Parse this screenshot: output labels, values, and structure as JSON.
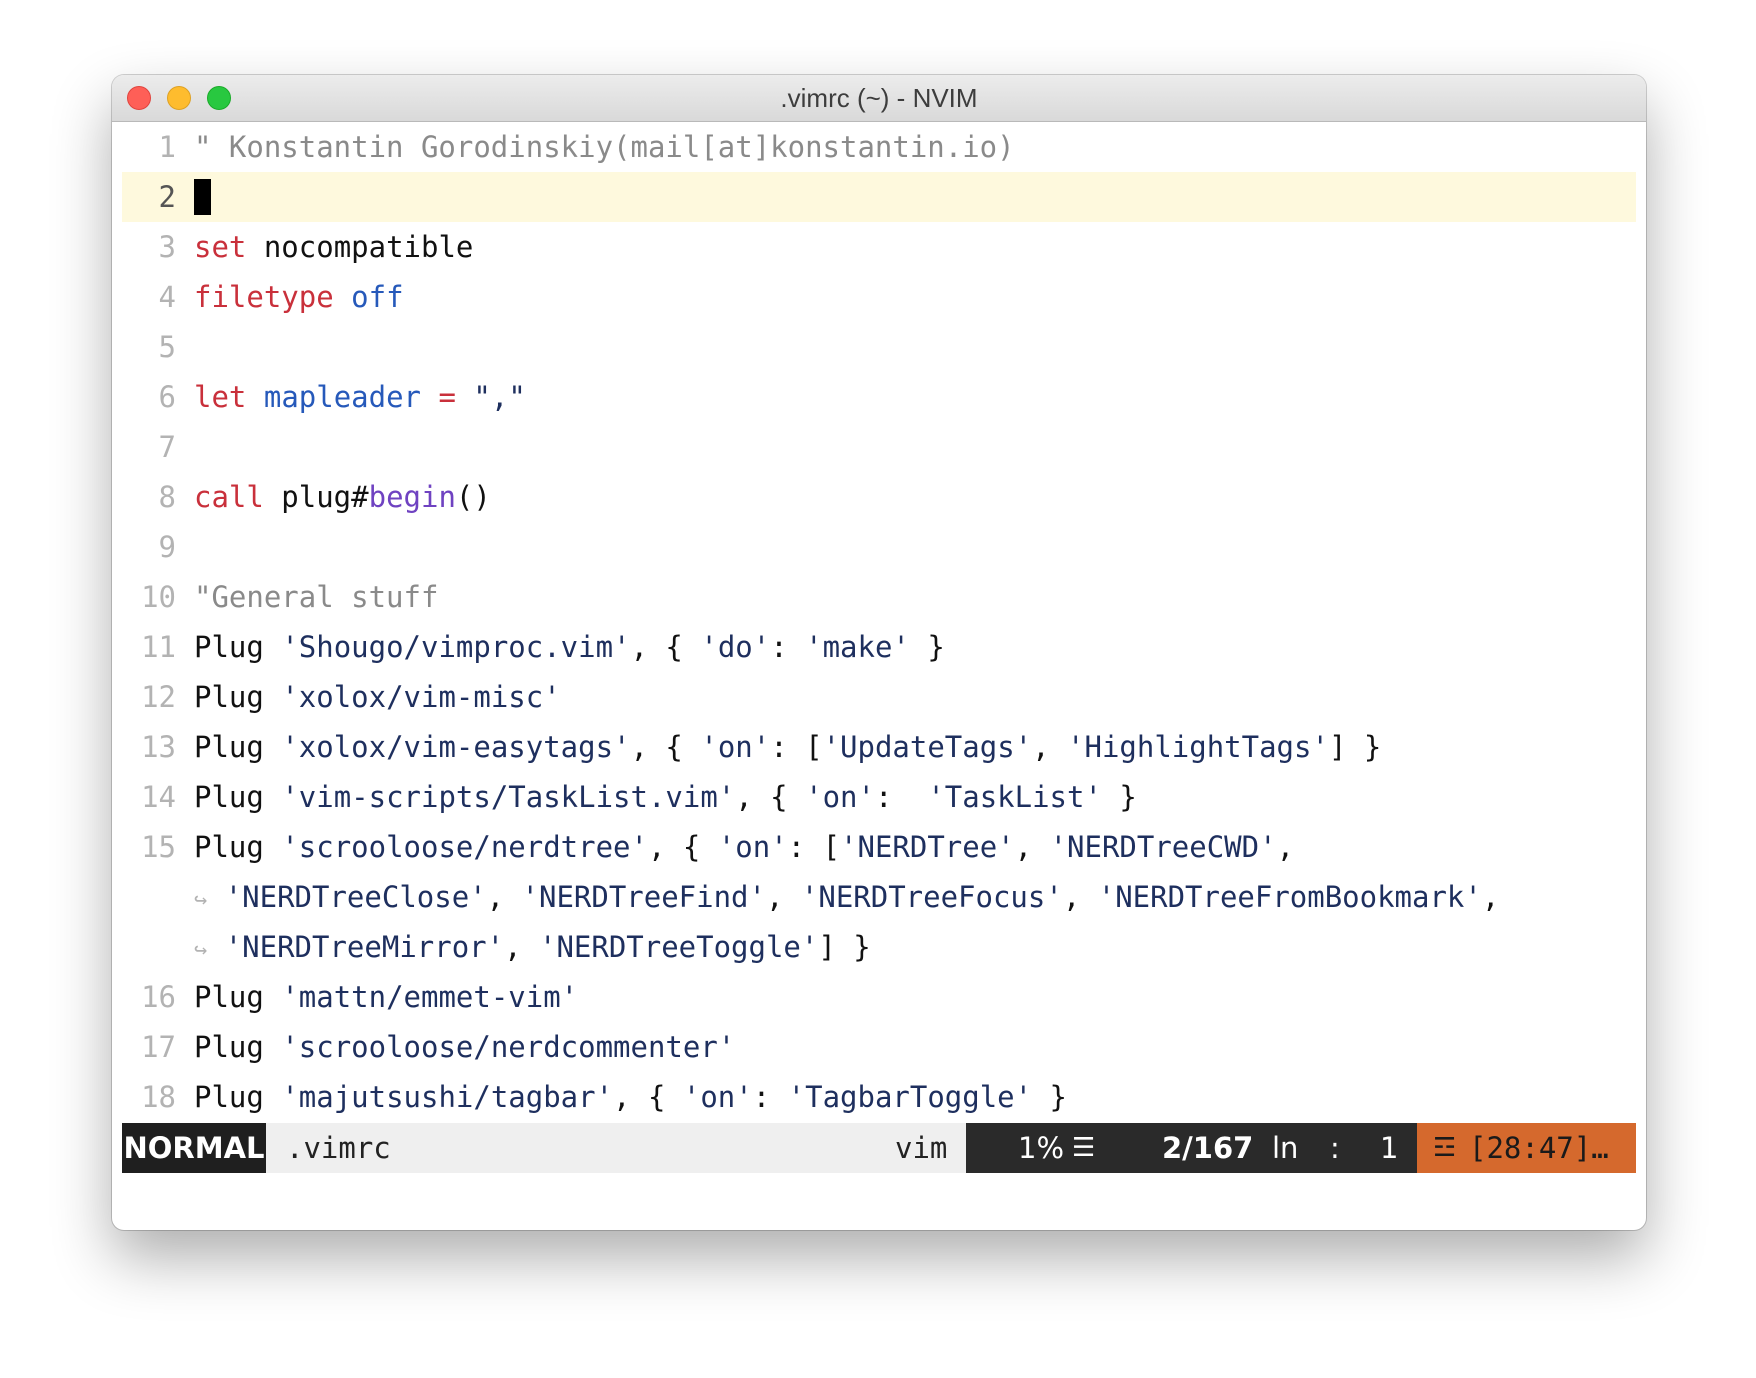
{
  "window": {
    "title": ".vimrc (~) - NVIM"
  },
  "editor": {
    "current_line": 2,
    "lines": [
      {
        "num": "1",
        "segments": [
          {
            "t": "\" Konstantin Gorodinskiy(mail[at]konstantin.io)",
            "c": "comment"
          }
        ]
      },
      {
        "num": "2",
        "cursor": true,
        "segments": []
      },
      {
        "num": "3",
        "segments": [
          {
            "t": "set",
            "c": "kw"
          },
          {
            "t": " nocompatible",
            "c": ""
          }
        ]
      },
      {
        "num": "4",
        "segments": [
          {
            "t": "filetype",
            "c": "kw"
          },
          {
            "t": " ",
            "c": ""
          },
          {
            "t": "off",
            "c": "blue"
          }
        ]
      },
      {
        "num": "5",
        "segments": []
      },
      {
        "num": "6",
        "segments": [
          {
            "t": "let",
            "c": "kw"
          },
          {
            "t": " ",
            "c": ""
          },
          {
            "t": "mapleader",
            "c": "blue"
          },
          {
            "t": " ",
            "c": ""
          },
          {
            "t": "=",
            "c": "kw"
          },
          {
            "t": " \",\"",
            "c": "str"
          }
        ]
      },
      {
        "num": "7",
        "segments": []
      },
      {
        "num": "8",
        "segments": [
          {
            "t": "call",
            "c": "kw"
          },
          {
            "t": " plug#",
            "c": ""
          },
          {
            "t": "begin",
            "c": "fn"
          },
          {
            "t": "()",
            "c": ""
          }
        ]
      },
      {
        "num": "9",
        "segments": []
      },
      {
        "num": "10",
        "segments": [
          {
            "t": "\"General stuff",
            "c": "comment"
          }
        ]
      },
      {
        "num": "11",
        "segments": [
          {
            "t": "Plug ",
            "c": ""
          },
          {
            "t": "'Shougo/vimproc.vim'",
            "c": "str"
          },
          {
            "t": ", { ",
            "c": ""
          },
          {
            "t": "'do'",
            "c": "str"
          },
          {
            "t": ": ",
            "c": ""
          },
          {
            "t": "'make'",
            "c": "str"
          },
          {
            "t": " }",
            "c": ""
          }
        ]
      },
      {
        "num": "12",
        "segments": [
          {
            "t": "Plug ",
            "c": ""
          },
          {
            "t": "'xolox/vim-misc'",
            "c": "str"
          }
        ]
      },
      {
        "num": "13",
        "segments": [
          {
            "t": "Plug ",
            "c": ""
          },
          {
            "t": "'xolox/vim-easytags'",
            "c": "str"
          },
          {
            "t": ", { ",
            "c": ""
          },
          {
            "t": "'on'",
            "c": "str"
          },
          {
            "t": ": [",
            "c": ""
          },
          {
            "t": "'UpdateTags'",
            "c": "str"
          },
          {
            "t": ", ",
            "c": ""
          },
          {
            "t": "'HighlightTags'",
            "c": "str"
          },
          {
            "t": "] }",
            "c": ""
          }
        ]
      },
      {
        "num": "14",
        "segments": [
          {
            "t": "Plug ",
            "c": ""
          },
          {
            "t": "'vim-scripts/TaskList.vim'",
            "c": "str"
          },
          {
            "t": ", { ",
            "c": ""
          },
          {
            "t": "'on'",
            "c": "str"
          },
          {
            "t": ":  ",
            "c": ""
          },
          {
            "t": "'TaskList'",
            "c": "str"
          },
          {
            "t": " }",
            "c": ""
          }
        ]
      },
      {
        "num": "15",
        "segments": [
          {
            "t": "Plug ",
            "c": ""
          },
          {
            "t": "'scrooloose/nerdtree'",
            "c": "str"
          },
          {
            "t": ", { ",
            "c": ""
          },
          {
            "t": "'on'",
            "c": "str"
          },
          {
            "t": ": [",
            "c": ""
          },
          {
            "t": "'NERDTree'",
            "c": "str"
          },
          {
            "t": ", ",
            "c": ""
          },
          {
            "t": "'NERDTreeCWD'",
            "c": "str"
          },
          {
            "t": ",",
            "c": ""
          }
        ]
      },
      {
        "num": "",
        "wrap": true,
        "segments": [
          {
            "t": "'NERDTreeClose'",
            "c": "str"
          },
          {
            "t": ", ",
            "c": ""
          },
          {
            "t": "'NERDTreeFind'",
            "c": "str"
          },
          {
            "t": ", ",
            "c": ""
          },
          {
            "t": "'NERDTreeFocus'",
            "c": "str"
          },
          {
            "t": ", ",
            "c": ""
          },
          {
            "t": "'NERDTreeFromBookmark'",
            "c": "str"
          },
          {
            "t": ",",
            "c": ""
          }
        ]
      },
      {
        "num": "",
        "wrap": true,
        "segments": [
          {
            "t": "'NERDTreeMirror'",
            "c": "str"
          },
          {
            "t": ", ",
            "c": ""
          },
          {
            "t": "'NERDTreeToggle'",
            "c": "str"
          },
          {
            "t": "] }",
            "c": ""
          }
        ]
      },
      {
        "num": "16",
        "segments": [
          {
            "t": "Plug ",
            "c": ""
          },
          {
            "t": "'mattn/emmet-vim'",
            "c": "str"
          }
        ]
      },
      {
        "num": "17",
        "segments": [
          {
            "t": "Plug ",
            "c": ""
          },
          {
            "t": "'scrooloose/nerdcommenter'",
            "c": "str"
          }
        ]
      },
      {
        "num": "18",
        "segments": [
          {
            "t": "Plug ",
            "c": ""
          },
          {
            "t": "'majutsushi/tagbar'",
            "c": "str"
          },
          {
            "t": ", { ",
            "c": ""
          },
          {
            "t": "'on'",
            "c": "str"
          },
          {
            "t": ": ",
            "c": ""
          },
          {
            "t": "'TagbarToggle'",
            "c": "str"
          },
          {
            "t": " }",
            "c": ""
          }
        ]
      }
    ]
  },
  "wrap_marker": "↪",
  "statusline": {
    "mode": "NORMAL",
    "filename": ".vimrc",
    "filetype": "vim",
    "percent": "1%",
    "position": "2/167",
    "ln_label": "ln",
    "colon": ":",
    "column": "1",
    "warning": "[28:47]…",
    "menu_icon": "menu-icon",
    "warning_icon": "indent-warning-icon"
  },
  "colors": {
    "keyword": "#c9303b",
    "identifier": "#2659ba",
    "string": "#1e2f5e",
    "function": "#6f42c1",
    "comment": "#8a8a8a",
    "current_line_bg": "#fef9dd",
    "mode_bg": "#1f1f1f",
    "warning_bg": "#d5692d"
  }
}
